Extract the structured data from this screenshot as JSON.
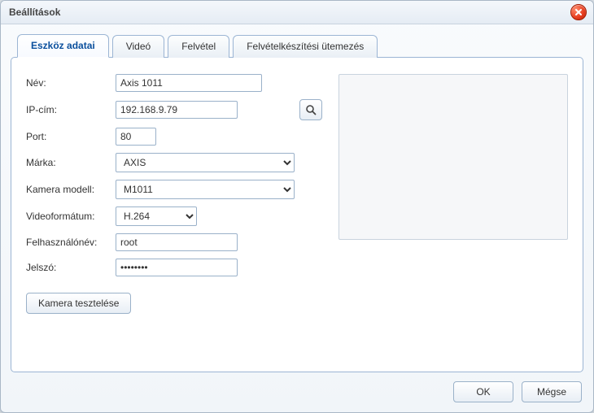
{
  "window": {
    "title": "Beállítások"
  },
  "tabs": {
    "device": "Eszköz adatai",
    "video": "Videó",
    "recording": "Felvétel",
    "schedule": "Felvételkészítési ütemezés"
  },
  "labels": {
    "name": "Név:",
    "ip": "IP-cím:",
    "port": "Port:",
    "brand": "Márka:",
    "model": "Kamera modell:",
    "format": "Videoformátum:",
    "user": "Felhasználónév:",
    "password": "Jelszó:"
  },
  "values": {
    "name": "Axis 1011",
    "ip": "192.168.9.79",
    "port": "80",
    "brand": "AXIS",
    "model": "M1011",
    "format": "H.264",
    "user": "root",
    "password": "••••••••"
  },
  "buttons": {
    "test_camera": "Kamera tesztelése",
    "ok": "OK",
    "cancel": "Mégse"
  }
}
